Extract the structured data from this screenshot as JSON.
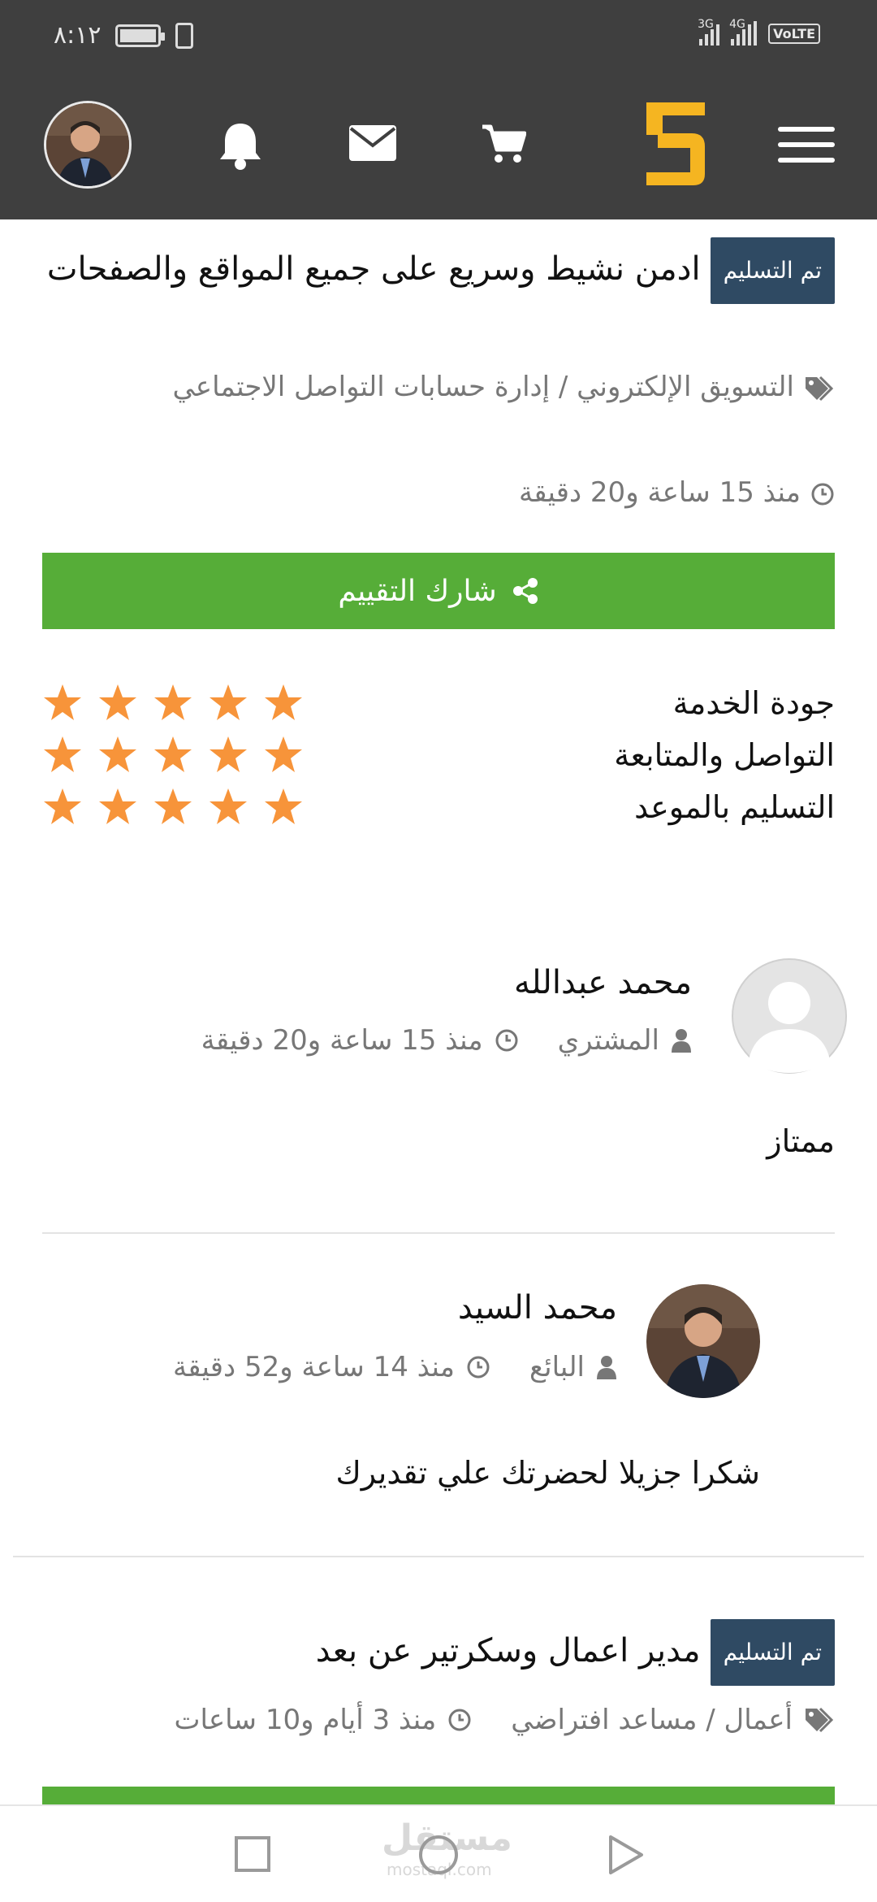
{
  "status_bar": {
    "time": "٨:١٢",
    "network_left": "3G",
    "network_right": "4G",
    "volte": "VoLTE"
  },
  "nav": {
    "logo_text": "5",
    "accent_color": "#f5b521",
    "icons": [
      "user-avatar",
      "bell-icon",
      "envelope-icon",
      "cart-icon",
      "menu-icon"
    ]
  },
  "project1": {
    "status_badge": "تم التسليم",
    "title": "ادمن نشيط وسريع على جميع المواقع والصفحات",
    "category": "التسويق الإلكتروني / إدارة حسابات التواصل الاجتماعي",
    "time_ago": "منذ 15 ساعة و20 دقيقة"
  },
  "share_button": "شارك التقييم",
  "ratings": [
    {
      "label": "جودة الخدمة",
      "stars": 5
    },
    {
      "label": "التواصل والمتابعة",
      "stars": 5
    },
    {
      "label": "التسليم بالموعد",
      "stars": 5
    }
  ],
  "buyer_comment": {
    "name": "محمد عبدالله",
    "role": "المشتري",
    "time_ago": "منذ 15 ساعة و20 دقيقة",
    "text": "ممتاز"
  },
  "seller_reply": {
    "name": "محمد السيد",
    "role": "البائع",
    "time_ago": "منذ 14 ساعة و52 دقيقة",
    "text": "شكرا جزيلا لحضرتك علي تقديرك"
  },
  "project2": {
    "status_badge": "تم التسليم",
    "title": "مدير اعمال وسكرتير عن بعد",
    "category": "أعمال / مساعد افتراضي",
    "time_ago": "منذ 3 أيام و10 ساعات"
  },
  "watermark": {
    "arabic": "مستقل",
    "latin": "mostaql.com"
  },
  "colors": {
    "header_bg": "#3f3f3f",
    "badge_bg": "#2f4a63",
    "green": "#56ad38",
    "star": "#f7943a"
  }
}
